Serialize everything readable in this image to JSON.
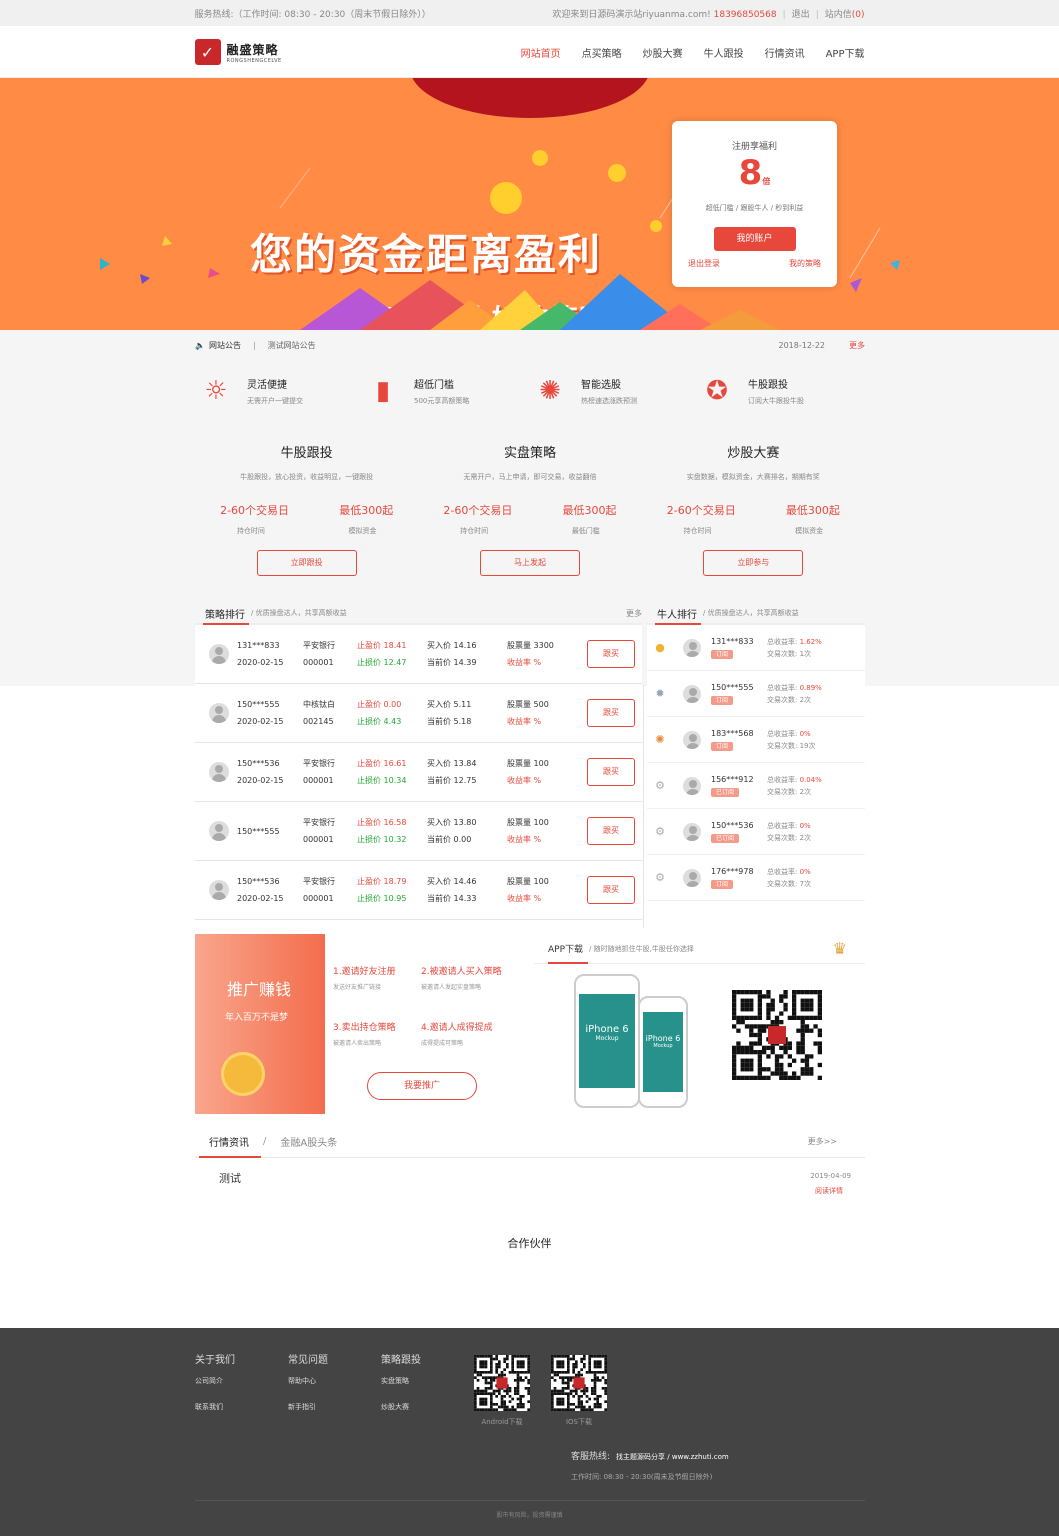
{
  "topbar": {
    "hotline": "服务热线:（工作时间: 08:30 - 20:30（周末节假日除外））",
    "welcome": "欢迎来到日源码演示站riyuanma.com!",
    "phone": "18396850568",
    "logout": "退出",
    "msg": "站内信",
    "msg_count": "(0)"
  },
  "logo": {
    "cn": "融盛策略",
    "en": "RONGSHENGCELVE"
  },
  "nav": [
    "网站首页",
    "点买策略",
    "炒股大赛",
    "牛人跟投",
    "行情资讯",
    "APP下载"
  ],
  "banner": {
    "line1": "您的资金距离盈利",
    "line2": "只有一个好的策略"
  },
  "reg": {
    "title": "注册享福利",
    "num": "8",
    "unit": "倍",
    "desc": "超低门槛 / 跟股牛人 / 秒到利益",
    "btn": "我的账户",
    "left": "退出登录",
    "right": "我的策略"
  },
  "notice": {
    "label": "网站公告",
    "text": "测试网站公告",
    "date": "2018-12-22",
    "more": "更多"
  },
  "features": [
    {
      "n": "灵活便捷",
      "s": "无需开户一键提交"
    },
    {
      "n": "超低门槛",
      "s": "500元享高额策略"
    },
    {
      "n": "智能选股",
      "s": "热榜速选涨跌预测"
    },
    {
      "n": "牛股跟投",
      "s": "订阅大牛跟投牛股"
    }
  ],
  "plans": [
    {
      "t": "牛股跟投",
      "d": "牛股跟投，放心投资，收益明显，一键跟投",
      "v1": "2-60个交易日",
      "v2": "最低300起",
      "l1": "持仓时间",
      "l2": "模拟资金",
      "btn": "立即跟投"
    },
    {
      "t": "实盘策略",
      "d": "无需开户，马上申请，即可交易，收益翻倍",
      "v1": "2-60个交易日",
      "v2": "最低300起",
      "l1": "持仓时间",
      "l2": "最低门槛",
      "btn": "马上发起"
    },
    {
      "t": "炒股大赛",
      "d": "实盘数据，模拟资金，大赛排名，期期有奖",
      "v1": "2-60个交易日",
      "v2": "最低300起",
      "l1": "持仓时间",
      "l2": "模拟资金",
      "btn": "立即参与"
    }
  ],
  "rank": {
    "title": "策略排行",
    "sub": "/ 优质操盘达人，共享高额收益",
    "more": "更多",
    "buy": "跟买",
    "rows": [
      {
        "u": "131***833",
        "d": "2020-02-15",
        "s": "平安银行",
        "c": "000001",
        "zy": "止盈价 18.41",
        "zs": "止损价 12.47",
        "bp": "买入价 14.16",
        "cp": "当前价 14.39",
        "q": "股票量 3300",
        "r": "收益率 %"
      },
      {
        "u": "150***555",
        "d": "2020-02-15",
        "s": "中核钛白",
        "c": "002145",
        "zy": "止盈价 0.00",
        "zs": "止损价 4.43",
        "bp": "买入价 5.11",
        "cp": "当前价 5.18",
        "q": "股票量 500",
        "r": "收益率 %"
      },
      {
        "u": "150***536",
        "d": "2020-02-15",
        "s": "平安银行",
        "c": "000001",
        "zy": "止盈价 16.61",
        "zs": "止损价 10.34",
        "bp": "买入价 13.84",
        "cp": "当前价 12.75",
        "q": "股票量 100",
        "r": "收益率 %"
      },
      {
        "u": "150***555",
        "d": "",
        "s": "平安银行",
        "c": "000001",
        "zy": "止盈价 16.58",
        "zs": "止损价 10.32",
        "bp": "买入价 13.80",
        "cp": "当前价 0.00",
        "q": "股票量 100",
        "r": "收益率 %"
      },
      {
        "u": "150***536",
        "d": "2020-02-15",
        "s": "平安银行",
        "c": "000001",
        "zy": "止盈价 18.79",
        "zs": "止损价 10.95",
        "bp": "买入价 14.46",
        "cp": "当前价 14.33",
        "q": "股票量 100",
        "r": "收益率 %"
      }
    ]
  },
  "niu": {
    "title": "牛人排行",
    "sub": "/ 优质操盘达人，共享高额收益",
    "rows": [
      {
        "u": "131***833",
        "tag": "订阅",
        "rate": "1.62%",
        "times": "1次"
      },
      {
        "u": "150***555",
        "tag": "订阅",
        "rate": "0.89%",
        "times": "2次"
      },
      {
        "u": "183***568",
        "tag": "订阅",
        "rate": "0%",
        "times": "19次"
      },
      {
        "u": "156***912",
        "tag": "已订阅",
        "rate": "0.04%",
        "times": "2次"
      },
      {
        "u": "150***536",
        "tag": "已订阅",
        "rate": "0%",
        "times": "2次"
      },
      {
        "u": "176***978",
        "tag": "订阅",
        "rate": "0%",
        "times": "7次"
      }
    ],
    "rl": "总收益率:",
    "tl": "交易次数:"
  },
  "promo": {
    "a": "推广赚钱",
    "b": "年入百万不是梦",
    "i1t": "1.邀请好友注册",
    "i1s": "发送好友推广链接",
    "i2t": "2.被邀请人买入策略",
    "i2s": "被邀请人发起实盘策略",
    "i3t": "3.卖出持仓策略",
    "i3s": "被邀请人卖出策略",
    "i4t": "4.邀请人成得提成",
    "i4s": "成得提成可策略",
    "btn": "我要推广"
  },
  "app": {
    "title": "APP下载",
    "sub": "/ 随时随地抓住牛股,牛股任你选择",
    "p1": "iPhone 6",
    "p2": "iPhone 6",
    "mock": "Mockup"
  },
  "news": {
    "tab1": "行情资讯",
    "tab2": "金融A股头条",
    "more": "更多>>",
    "item": "测试",
    "date": "2019-04-09",
    "read": "阅读详情"
  },
  "partner": "合作伙伴",
  "footer": {
    "c1h": "关于我们",
    "c1a": "公司简介",
    "c1b": "联系我们",
    "c2h": "常见问题",
    "c2a": "帮助中心",
    "c2b": "新手指引",
    "c3h": "策略跟投",
    "c3a": "实盘策略",
    "c3b": "炒股大赛",
    "q1": "Android下载",
    "q2": "IOS下载",
    "hot": "客服热线:",
    "hotv": "找主题源码分享 / www.zzhuti.com",
    "work": "工作时间: 08:30 - 20:30(周末及节假日除外)",
    "copy": "股市有风险，投资需谨慎"
  }
}
